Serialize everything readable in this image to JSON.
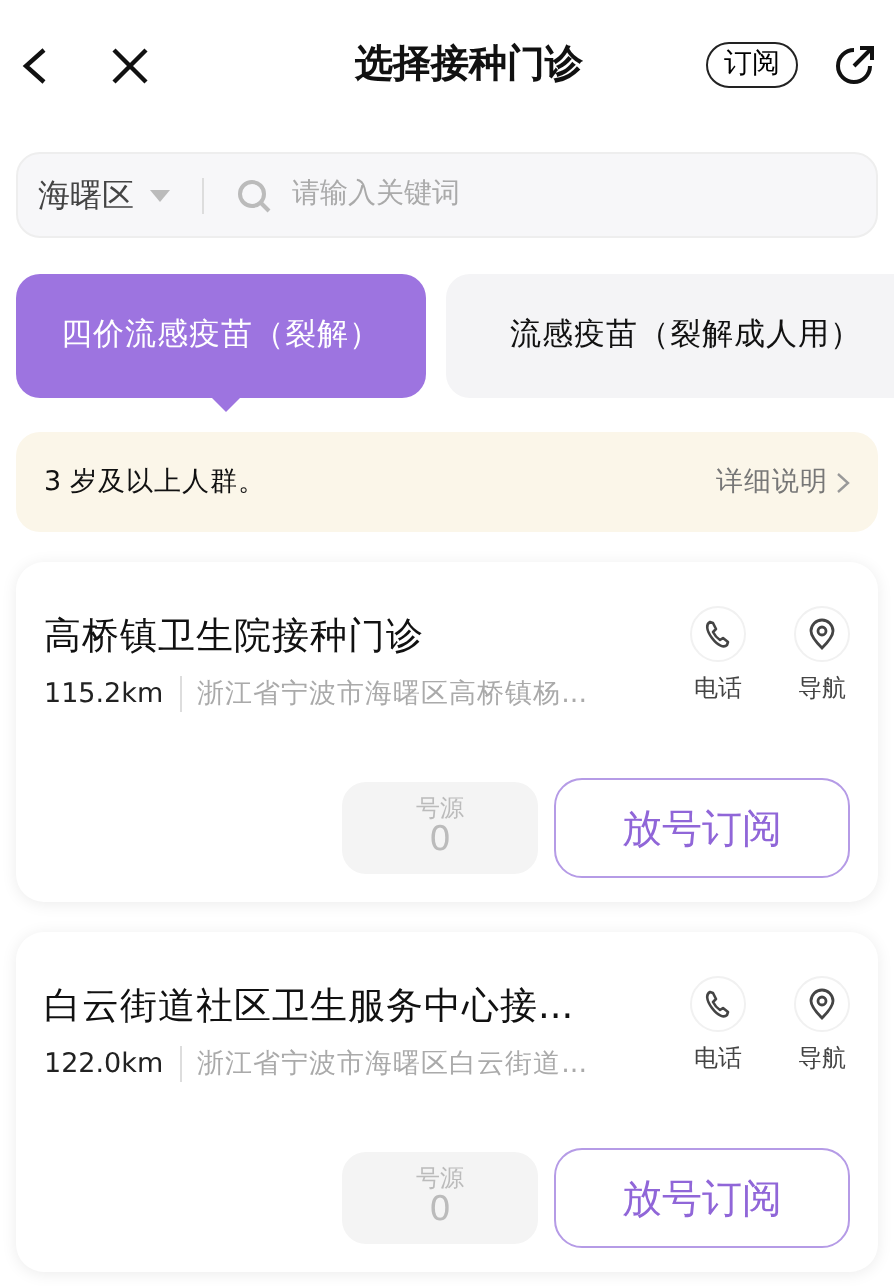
{
  "header": {
    "title": "选择接种门诊",
    "subscribe_label": "订阅"
  },
  "search": {
    "district": "海曙区",
    "placeholder": "请输入关键词"
  },
  "tabs": [
    {
      "label": "四价流感疫苗（裂解）",
      "selected": true
    },
    {
      "label": "流感疫苗（裂解成人用）",
      "selected": false
    }
  ],
  "notice": {
    "text": "3 岁及以上人群。",
    "link": "详细说明"
  },
  "clinics": [
    {
      "name": "高桥镇卫生院接种门诊",
      "distance": "115.2km",
      "address": "浙江省宁波市海曙区高桥镇杨...",
      "phone_label": "电话",
      "nav_label": "导航",
      "slots_label": "号源",
      "slots": "0",
      "button": "放号订阅"
    },
    {
      "name": "白云街道社区卫生服务中心接...",
      "distance": "122.0km",
      "address": "浙江省宁波市海曙区白云街道...",
      "phone_label": "电话",
      "nav_label": "导航",
      "slots_label": "号源",
      "slots": "0",
      "button": "放号订阅"
    }
  ]
}
